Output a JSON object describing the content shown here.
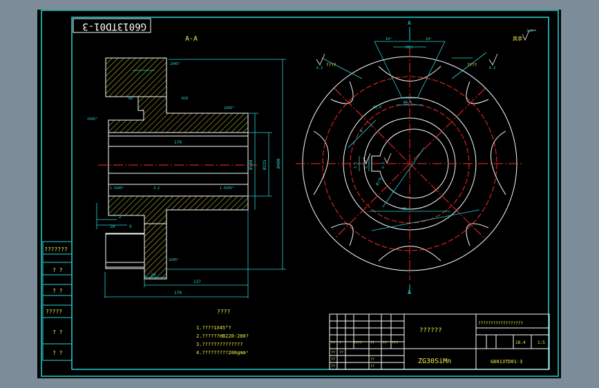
{
  "drawing_number": "G6013TD01-3",
  "section_label": "A-A",
  "section_marker": "A",
  "material": "ZG30SiMn",
  "tech_requirements": {
    "title": "????",
    "items": [
      "1.????1X45°?",
      "2.??????HB220-280?",
      "3.??????????????",
      "4.?????????200gmm²"
    ]
  },
  "roughness_note": "其余",
  "dims_section": {
    "overall_length": "170",
    "hub_length": "127",
    "bore_length": "170",
    "flange_gap": "9",
    "d_outer": "Ø400",
    "d_bore": "Ø160",
    "d_hub": "Ø225",
    "small_1": "20",
    "small_2": "10",
    "small_3": "2",
    "chamfer_top": "2X45°",
    "chamfer_mid": "2X45°",
    "chamfer_hub": "2X45°",
    "chamfer_bottom": "2X45°",
    "chamfer_left": "2X45°",
    "radius_1": "R8",
    "radius_2": "R20",
    "fit_left": "1.5X45°",
    "fit_right": "1.5X45°",
    "roughness": "3.2"
  },
  "dims_view": {
    "angle_left": "10°",
    "angle_right": "10°",
    "slot_width": "(R5)",
    "pitch": "Ø4.9",
    "key_width": "Ø1.6",
    "bore": "Ø170",
    "key_depth": "29.4",
    "diag_1": "Ø",
    "dim_side": "3.5",
    "dim_side2": "5.4",
    "rough_1": "6.3",
    "rough_2": "6.3",
    "rough_3": "6.3",
    "rough_4": "3.2",
    "note_left": "????",
    "note_right": "????"
  },
  "side_table": [
    "???????",
    "? ?",
    "? ?",
    "?????",
    "? ?",
    "? ?"
  ],
  "title_block": {
    "part_name": "??????",
    "company": "??????????????????",
    "scale": "1:5",
    "weight": "18.4",
    "material": "ZG30SiMn",
    "drawing_no": "G6013TD01-3",
    "row_labels": [
      "??",
      "?",
      "????",
      "??",
      "??",
      "???"
    ],
    "row_labels_2": [
      "??",
      "??",
      "??",
      "??"
    ],
    "sig_labels": [
      "??",
      "??"
    ]
  },
  "colors": {
    "outline": "#ffffff",
    "dimension": "#29d6d6",
    "text": "#f2f24a",
    "green_text": "#7fd36a",
    "center_line": "#ff2a2a",
    "hatch": "#f2f24a",
    "frame": "#29d6d6"
  }
}
